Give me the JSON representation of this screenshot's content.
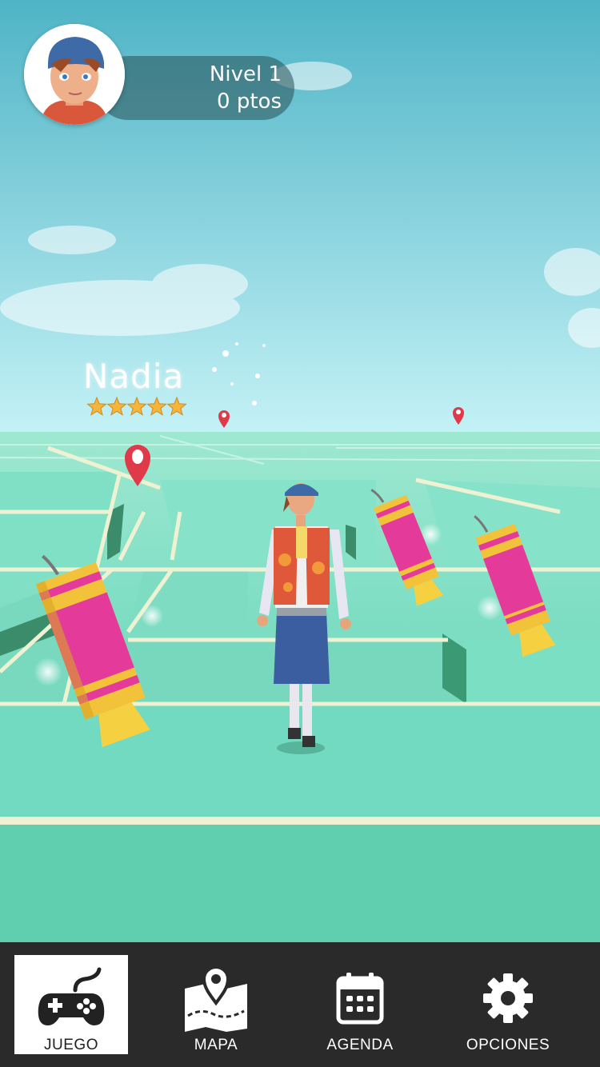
{
  "player": {
    "level_label": "Nivel 1",
    "points_label": "0 ptos"
  },
  "location": {
    "name": "Nadia",
    "stars": 5
  },
  "nav": {
    "items": [
      {
        "label": "JUEGO",
        "icon": "gamepad-icon",
        "active": true
      },
      {
        "label": "MAPA",
        "icon": "map-icon",
        "active": false
      },
      {
        "label": "AGENDA",
        "icon": "calendar-icon",
        "active": false
      },
      {
        "label": "OPCIONES",
        "icon": "gear-icon",
        "active": false
      }
    ]
  },
  "colors": {
    "sky_top": "#4fb4c6",
    "sky_bottom": "#bdeff5",
    "ground": "#5fcfb0",
    "road": "#e8f0d0",
    "nav_bg": "#2a2a2a",
    "pin": "#e03a4a",
    "firecracker_body": "#f2c23a",
    "firecracker_band": "#e43a9a",
    "star": "#f3b53c"
  }
}
